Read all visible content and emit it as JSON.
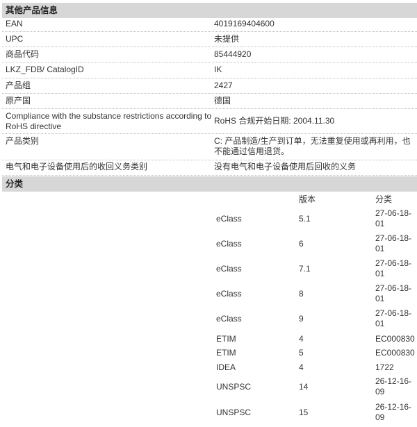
{
  "other_info": {
    "title": "其他产品信息",
    "rows": [
      {
        "label": "EAN",
        "value": "4019169404600"
      },
      {
        "label": "UPC",
        "value": "未提供"
      },
      {
        "label": "商品代码",
        "value": "85444920"
      },
      {
        "label": "LKZ_FDB/ CatalogID",
        "value": "IK"
      },
      {
        "label": "产品组",
        "value": "2427"
      },
      {
        "label": "原产国",
        "value": "德国"
      },
      {
        "label": "Compliance with the substance restrictions according to RoHS directive",
        "value": "RoHS 合规开始日期: 2004.11.30"
      },
      {
        "label": "产品类别",
        "value": "C: 产品制造/生产到订单，无法重复使用或再利用，也不能通过信用退货。"
      },
      {
        "label": "电气和电子设备使用后的收回义务类别",
        "value": "没有电气和电子设备使用后回收的义务"
      }
    ]
  },
  "classification": {
    "title": "分类",
    "headers": {
      "version": "版本",
      "class": "分类"
    },
    "rows": [
      {
        "system": "eClass",
        "version": "5.1",
        "class": "27-06-18-01"
      },
      {
        "system": "eClass",
        "version": "6",
        "class": "27-06-18-01"
      },
      {
        "system": "eClass",
        "version": "7.1",
        "class": "27-06-18-01"
      },
      {
        "system": "eClass",
        "version": "8",
        "class": "27-06-18-01"
      },
      {
        "system": "eClass",
        "version": "9",
        "class": "27-06-18-01"
      },
      {
        "system": "ETIM",
        "version": "4",
        "class": "EC000830"
      },
      {
        "system": "ETIM",
        "version": "5",
        "class": "EC000830"
      },
      {
        "system": "IDEA",
        "version": "4",
        "class": "1722"
      },
      {
        "system": "UNSPSC",
        "version": "14",
        "class": "26-12-16-09"
      },
      {
        "system": "UNSPSC",
        "version": "15",
        "class": "26-12-16-09"
      }
    ]
  }
}
